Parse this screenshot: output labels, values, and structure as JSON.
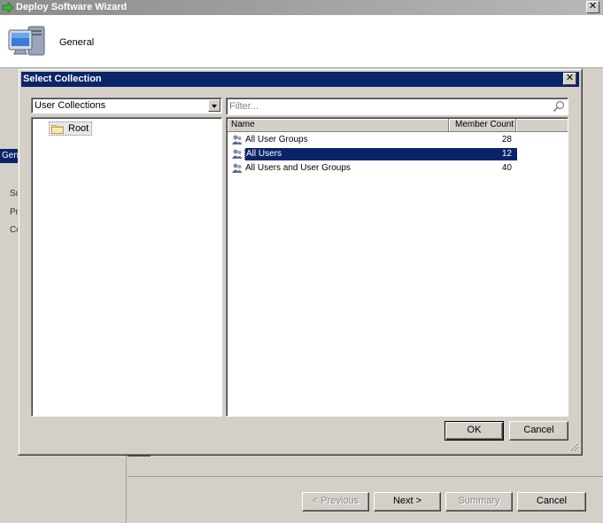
{
  "wizard": {
    "title": "Deploy Software Wizard",
    "header_title": "General",
    "left_nav": {
      "selected_label": "General",
      "items": [
        "Subject",
        "Preview",
        "Complete"
      ]
    },
    "buttons": {
      "previous": "< Previous",
      "next": "Next >",
      "summary": "Summary",
      "cancel": "Cancel"
    }
  },
  "dialog": {
    "title": "Select Collection",
    "collection_type": "User Collections",
    "tree": {
      "root_label": "Root"
    },
    "filter": {
      "placeholder": "Filter..."
    },
    "list": {
      "columns": {
        "name": "Name",
        "member_count": "Member Count"
      },
      "rows": [
        {
          "name": "All User Groups",
          "count": "28",
          "selected": false
        },
        {
          "name": "All Users",
          "count": "12",
          "selected": true
        },
        {
          "name": "All Users and User Groups",
          "count": "40",
          "selected": false
        }
      ]
    },
    "buttons": {
      "ok": "OK",
      "cancel": "Cancel"
    }
  },
  "colors": {
    "selection": "#0a246a",
    "face": "#d4d0c8"
  }
}
